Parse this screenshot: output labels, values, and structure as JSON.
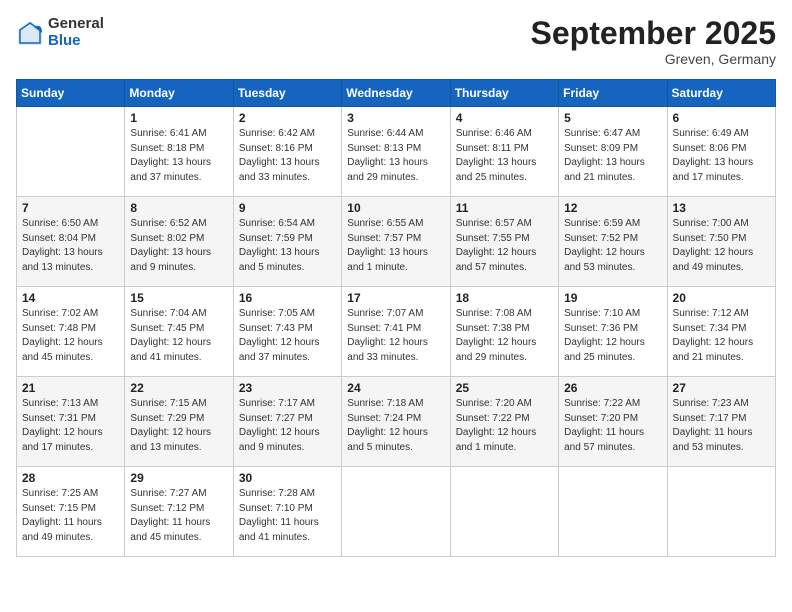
{
  "logo": {
    "general": "General",
    "blue": "Blue"
  },
  "title": "September 2025",
  "subtitle": "Greven, Germany",
  "days_of_week": [
    "Sunday",
    "Monday",
    "Tuesday",
    "Wednesday",
    "Thursday",
    "Friday",
    "Saturday"
  ],
  "weeks": [
    [
      {
        "day": "",
        "info": ""
      },
      {
        "day": "1",
        "info": "Sunrise: 6:41 AM\nSunset: 8:18 PM\nDaylight: 13 hours\nand 37 minutes."
      },
      {
        "day": "2",
        "info": "Sunrise: 6:42 AM\nSunset: 8:16 PM\nDaylight: 13 hours\nand 33 minutes."
      },
      {
        "day": "3",
        "info": "Sunrise: 6:44 AM\nSunset: 8:13 PM\nDaylight: 13 hours\nand 29 minutes."
      },
      {
        "day": "4",
        "info": "Sunrise: 6:46 AM\nSunset: 8:11 PM\nDaylight: 13 hours\nand 25 minutes."
      },
      {
        "day": "5",
        "info": "Sunrise: 6:47 AM\nSunset: 8:09 PM\nDaylight: 13 hours\nand 21 minutes."
      },
      {
        "day": "6",
        "info": "Sunrise: 6:49 AM\nSunset: 8:06 PM\nDaylight: 13 hours\nand 17 minutes."
      }
    ],
    [
      {
        "day": "7",
        "info": "Sunrise: 6:50 AM\nSunset: 8:04 PM\nDaylight: 13 hours\nand 13 minutes."
      },
      {
        "day": "8",
        "info": "Sunrise: 6:52 AM\nSunset: 8:02 PM\nDaylight: 13 hours\nand 9 minutes."
      },
      {
        "day": "9",
        "info": "Sunrise: 6:54 AM\nSunset: 7:59 PM\nDaylight: 13 hours\nand 5 minutes."
      },
      {
        "day": "10",
        "info": "Sunrise: 6:55 AM\nSunset: 7:57 PM\nDaylight: 13 hours\nand 1 minute."
      },
      {
        "day": "11",
        "info": "Sunrise: 6:57 AM\nSunset: 7:55 PM\nDaylight: 12 hours\nand 57 minutes."
      },
      {
        "day": "12",
        "info": "Sunrise: 6:59 AM\nSunset: 7:52 PM\nDaylight: 12 hours\nand 53 minutes."
      },
      {
        "day": "13",
        "info": "Sunrise: 7:00 AM\nSunset: 7:50 PM\nDaylight: 12 hours\nand 49 minutes."
      }
    ],
    [
      {
        "day": "14",
        "info": "Sunrise: 7:02 AM\nSunset: 7:48 PM\nDaylight: 12 hours\nand 45 minutes."
      },
      {
        "day": "15",
        "info": "Sunrise: 7:04 AM\nSunset: 7:45 PM\nDaylight: 12 hours\nand 41 minutes."
      },
      {
        "day": "16",
        "info": "Sunrise: 7:05 AM\nSunset: 7:43 PM\nDaylight: 12 hours\nand 37 minutes."
      },
      {
        "day": "17",
        "info": "Sunrise: 7:07 AM\nSunset: 7:41 PM\nDaylight: 12 hours\nand 33 minutes."
      },
      {
        "day": "18",
        "info": "Sunrise: 7:08 AM\nSunset: 7:38 PM\nDaylight: 12 hours\nand 29 minutes."
      },
      {
        "day": "19",
        "info": "Sunrise: 7:10 AM\nSunset: 7:36 PM\nDaylight: 12 hours\nand 25 minutes."
      },
      {
        "day": "20",
        "info": "Sunrise: 7:12 AM\nSunset: 7:34 PM\nDaylight: 12 hours\nand 21 minutes."
      }
    ],
    [
      {
        "day": "21",
        "info": "Sunrise: 7:13 AM\nSunset: 7:31 PM\nDaylight: 12 hours\nand 17 minutes."
      },
      {
        "day": "22",
        "info": "Sunrise: 7:15 AM\nSunset: 7:29 PM\nDaylight: 12 hours\nand 13 minutes."
      },
      {
        "day": "23",
        "info": "Sunrise: 7:17 AM\nSunset: 7:27 PM\nDaylight: 12 hours\nand 9 minutes."
      },
      {
        "day": "24",
        "info": "Sunrise: 7:18 AM\nSunset: 7:24 PM\nDaylight: 12 hours\nand 5 minutes."
      },
      {
        "day": "25",
        "info": "Sunrise: 7:20 AM\nSunset: 7:22 PM\nDaylight: 12 hours\nand 1 minute."
      },
      {
        "day": "26",
        "info": "Sunrise: 7:22 AM\nSunset: 7:20 PM\nDaylight: 11 hours\nand 57 minutes."
      },
      {
        "day": "27",
        "info": "Sunrise: 7:23 AM\nSunset: 7:17 PM\nDaylight: 11 hours\nand 53 minutes."
      }
    ],
    [
      {
        "day": "28",
        "info": "Sunrise: 7:25 AM\nSunset: 7:15 PM\nDaylight: 11 hours\nand 49 minutes."
      },
      {
        "day": "29",
        "info": "Sunrise: 7:27 AM\nSunset: 7:12 PM\nDaylight: 11 hours\nand 45 minutes."
      },
      {
        "day": "30",
        "info": "Sunrise: 7:28 AM\nSunset: 7:10 PM\nDaylight: 11 hours\nand 41 minutes."
      },
      {
        "day": "",
        "info": ""
      },
      {
        "day": "",
        "info": ""
      },
      {
        "day": "",
        "info": ""
      },
      {
        "day": "",
        "info": ""
      }
    ]
  ]
}
